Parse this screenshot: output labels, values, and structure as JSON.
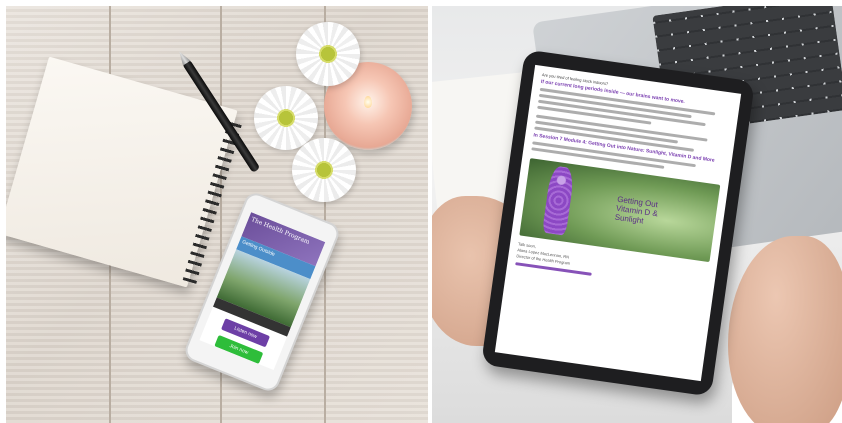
{
  "phone": {
    "app_title": "The Health Program",
    "band_text": "Getting Outside",
    "button_primary": "Listen now",
    "button_secondary": "Join now"
  },
  "tablet": {
    "intro": "Are you tired of feeling stuck indoors?",
    "heading": "If our current long periods inside — our brains want to move.",
    "section": "In Session 7 Module 4: Getting Out into Nature: Sunlight, Vitamin D and More",
    "image_text_line1": "Getting Out",
    "image_text_line2": "Vitamin D &",
    "image_text_line3": "Sunlight",
    "signoff": "Talk soon,",
    "sig_name": "Alana Lopez MacLennan, RN",
    "sig_role": "Director of the Health Program"
  }
}
